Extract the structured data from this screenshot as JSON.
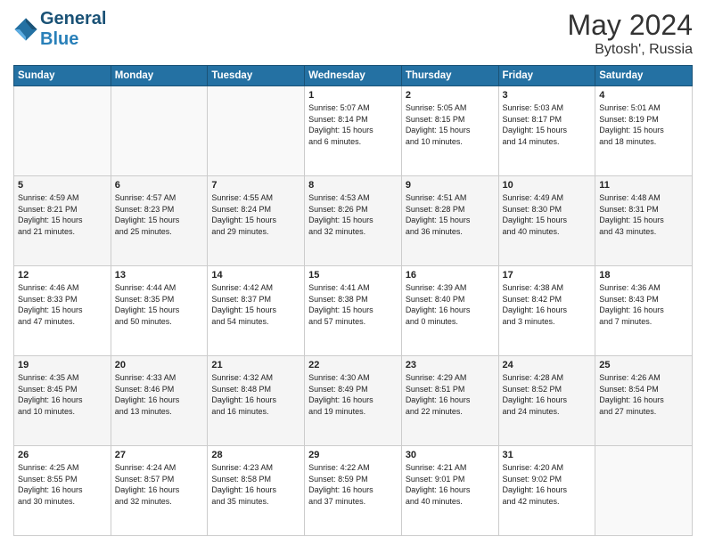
{
  "header": {
    "logo_line1": "General",
    "logo_line2": "Blue",
    "title": "May 2024",
    "location": "Bytosh', Russia"
  },
  "days_of_week": [
    "Sunday",
    "Monday",
    "Tuesday",
    "Wednesday",
    "Thursday",
    "Friday",
    "Saturday"
  ],
  "weeks": [
    [
      {
        "day": "",
        "info": ""
      },
      {
        "day": "",
        "info": ""
      },
      {
        "day": "",
        "info": ""
      },
      {
        "day": "1",
        "info": "Sunrise: 5:07 AM\nSunset: 8:14 PM\nDaylight: 15 hours\nand 6 minutes."
      },
      {
        "day": "2",
        "info": "Sunrise: 5:05 AM\nSunset: 8:15 PM\nDaylight: 15 hours\nand 10 minutes."
      },
      {
        "day": "3",
        "info": "Sunrise: 5:03 AM\nSunset: 8:17 PM\nDaylight: 15 hours\nand 14 minutes."
      },
      {
        "day": "4",
        "info": "Sunrise: 5:01 AM\nSunset: 8:19 PM\nDaylight: 15 hours\nand 18 minutes."
      }
    ],
    [
      {
        "day": "5",
        "info": "Sunrise: 4:59 AM\nSunset: 8:21 PM\nDaylight: 15 hours\nand 21 minutes."
      },
      {
        "day": "6",
        "info": "Sunrise: 4:57 AM\nSunset: 8:23 PM\nDaylight: 15 hours\nand 25 minutes."
      },
      {
        "day": "7",
        "info": "Sunrise: 4:55 AM\nSunset: 8:24 PM\nDaylight: 15 hours\nand 29 minutes."
      },
      {
        "day": "8",
        "info": "Sunrise: 4:53 AM\nSunset: 8:26 PM\nDaylight: 15 hours\nand 32 minutes."
      },
      {
        "day": "9",
        "info": "Sunrise: 4:51 AM\nSunset: 8:28 PM\nDaylight: 15 hours\nand 36 minutes."
      },
      {
        "day": "10",
        "info": "Sunrise: 4:49 AM\nSunset: 8:30 PM\nDaylight: 15 hours\nand 40 minutes."
      },
      {
        "day": "11",
        "info": "Sunrise: 4:48 AM\nSunset: 8:31 PM\nDaylight: 15 hours\nand 43 minutes."
      }
    ],
    [
      {
        "day": "12",
        "info": "Sunrise: 4:46 AM\nSunset: 8:33 PM\nDaylight: 15 hours\nand 47 minutes."
      },
      {
        "day": "13",
        "info": "Sunrise: 4:44 AM\nSunset: 8:35 PM\nDaylight: 15 hours\nand 50 minutes."
      },
      {
        "day": "14",
        "info": "Sunrise: 4:42 AM\nSunset: 8:37 PM\nDaylight: 15 hours\nand 54 minutes."
      },
      {
        "day": "15",
        "info": "Sunrise: 4:41 AM\nSunset: 8:38 PM\nDaylight: 15 hours\nand 57 minutes."
      },
      {
        "day": "16",
        "info": "Sunrise: 4:39 AM\nSunset: 8:40 PM\nDaylight: 16 hours\nand 0 minutes."
      },
      {
        "day": "17",
        "info": "Sunrise: 4:38 AM\nSunset: 8:42 PM\nDaylight: 16 hours\nand 3 minutes."
      },
      {
        "day": "18",
        "info": "Sunrise: 4:36 AM\nSunset: 8:43 PM\nDaylight: 16 hours\nand 7 minutes."
      }
    ],
    [
      {
        "day": "19",
        "info": "Sunrise: 4:35 AM\nSunset: 8:45 PM\nDaylight: 16 hours\nand 10 minutes."
      },
      {
        "day": "20",
        "info": "Sunrise: 4:33 AM\nSunset: 8:46 PM\nDaylight: 16 hours\nand 13 minutes."
      },
      {
        "day": "21",
        "info": "Sunrise: 4:32 AM\nSunset: 8:48 PM\nDaylight: 16 hours\nand 16 minutes."
      },
      {
        "day": "22",
        "info": "Sunrise: 4:30 AM\nSunset: 8:49 PM\nDaylight: 16 hours\nand 19 minutes."
      },
      {
        "day": "23",
        "info": "Sunrise: 4:29 AM\nSunset: 8:51 PM\nDaylight: 16 hours\nand 22 minutes."
      },
      {
        "day": "24",
        "info": "Sunrise: 4:28 AM\nSunset: 8:52 PM\nDaylight: 16 hours\nand 24 minutes."
      },
      {
        "day": "25",
        "info": "Sunrise: 4:26 AM\nSunset: 8:54 PM\nDaylight: 16 hours\nand 27 minutes."
      }
    ],
    [
      {
        "day": "26",
        "info": "Sunrise: 4:25 AM\nSunset: 8:55 PM\nDaylight: 16 hours\nand 30 minutes."
      },
      {
        "day": "27",
        "info": "Sunrise: 4:24 AM\nSunset: 8:57 PM\nDaylight: 16 hours\nand 32 minutes."
      },
      {
        "day": "28",
        "info": "Sunrise: 4:23 AM\nSunset: 8:58 PM\nDaylight: 16 hours\nand 35 minutes."
      },
      {
        "day": "29",
        "info": "Sunrise: 4:22 AM\nSunset: 8:59 PM\nDaylight: 16 hours\nand 37 minutes."
      },
      {
        "day": "30",
        "info": "Sunrise: 4:21 AM\nSunset: 9:01 PM\nDaylight: 16 hours\nand 40 minutes."
      },
      {
        "day": "31",
        "info": "Sunrise: 4:20 AM\nSunset: 9:02 PM\nDaylight: 16 hours\nand 42 minutes."
      },
      {
        "day": "",
        "info": ""
      }
    ]
  ]
}
